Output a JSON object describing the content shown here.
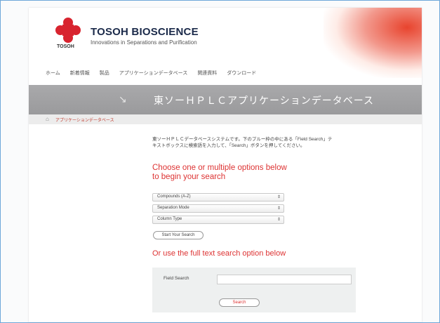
{
  "header": {
    "brand": "TOSOH BIOSCIENCE",
    "tagline": "Innovations in Separations and Purification",
    "logo_text": "TOSOH",
    "logo_color": "#d8242f"
  },
  "nav": {
    "items": [
      "ホーム",
      "新着情報",
      "製品",
      "アプリケーションデータベース",
      "関連資料",
      "ダウンロード"
    ]
  },
  "banner": {
    "title": "東ソーＨＰＬＣアプリケーションデータベース"
  },
  "breadcrumb": {
    "current": "アプリケーションデータベース"
  },
  "intro": {
    "text": "東ソーＨＰＬＣデータベースシステムです。下のプルー枠の中にある「Field Search」テキストボックスに検索語を入力して、「Search」ボタンを押してください。"
  },
  "options": {
    "heading_line1": "Choose one or multiple options below",
    "heading_line2": "to begin your search",
    "selects": [
      "Compounds (A-Z)",
      "Separation Mode",
      "Column Type"
    ],
    "start_label": "Start Your Search"
  },
  "fulltext": {
    "heading": "Or use the full text search option below",
    "field_label": "Field Search",
    "field_value": "",
    "button_label": "Search"
  }
}
